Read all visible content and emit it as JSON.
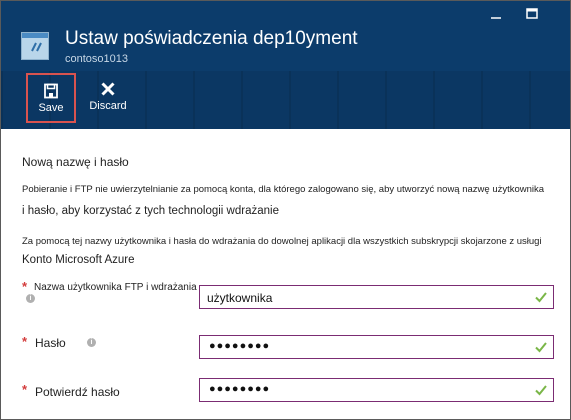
{
  "header": {
    "title": "Ustaw poświadczenia dep10yment",
    "subtitle": "contoso1013"
  },
  "toolbar": {
    "save_label": "Save",
    "discard_label": "Discard"
  },
  "section": {
    "title": "Nową nazwę i hasło",
    "paragraph1_line1": "Pobieranie i FTP nie uwierzytelnianie za pomocą konta, dla którego zalogowano się, aby utworzyć nową nazwę użytkownika",
    "paragraph1_line2": "i hasło, aby korzystać z tych technologii wdrażanie",
    "paragraph2_line1": "Za pomocą tej nazwy użytkownika i hasła do wdrażania do dowolnej aplikacji dla wszystkich subskrypcji skojarzone z usługi",
    "paragraph2_line2": "Konto Microsoft Azure"
  },
  "fields": {
    "username": {
      "label": "Nazwa użytkownika FTP i wdrażania",
      "value": "użytkownika",
      "required_mark": "*"
    },
    "password": {
      "label": "Hasło",
      "value": "●●●●●●●●",
      "required_mark": "*"
    },
    "confirm": {
      "label": "Potwierdź hasło",
      "value": "●●●●●●●●",
      "required_mark": "*"
    }
  },
  "colors": {
    "header_bg": "#0b3b6a",
    "highlight": "#d9534f",
    "field_border": "#7b2c73",
    "valid_check": "#7ab648",
    "required": "#d33c3c"
  }
}
